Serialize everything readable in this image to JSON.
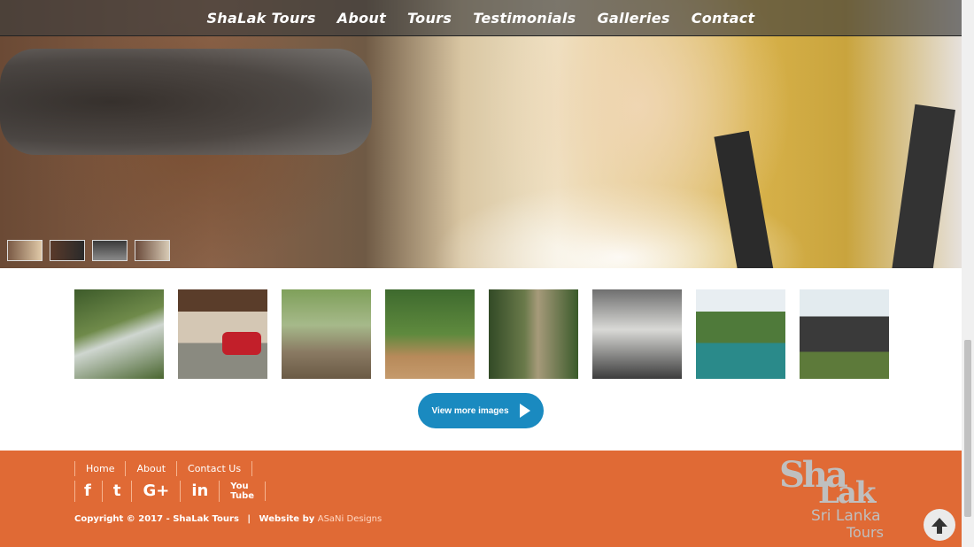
{
  "nav": {
    "brand": "ShaLak Tours",
    "items": [
      "About",
      "Tours",
      "Testimonials",
      "Galleries",
      "Contact"
    ]
  },
  "gallery": {
    "button_label": "View more images"
  },
  "footer": {
    "links": [
      "Home",
      "About",
      "Contact Us"
    ],
    "social_icons": [
      "facebook-icon",
      "twitter-icon",
      "google-plus-icon",
      "linkedin-icon",
      "youtube-icon"
    ],
    "social_glyphs": [
      "f",
      "🐦",
      "G+",
      "in",
      "You\nTube"
    ],
    "copyright": "Copyright © 2017 - ShaLak Tours",
    "separator": "|",
    "website_by": "Website by",
    "designer": "ASaNi Designs"
  },
  "logo": {
    "line1": "Sha",
    "line2": "Lak",
    "line3": "Sri Lanka",
    "line4": "Tours"
  },
  "colors": {
    "footer_bg": "#e06a35",
    "button_bg": "#1a8ac0"
  }
}
